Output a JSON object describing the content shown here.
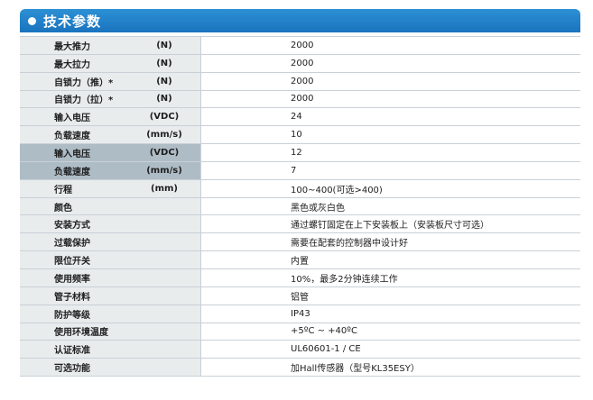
{
  "header": {
    "title": "技术参数"
  },
  "rows": [
    {
      "name": "最大推力",
      "unit": "(N)",
      "value": "2000"
    },
    {
      "name": "最大拉力",
      "unit": "(N)",
      "value": "2000"
    },
    {
      "name": "自锁力（推）*",
      "unit": "(N)",
      "value": "2000"
    },
    {
      "name": "自锁力（拉）*",
      "unit": "(N)",
      "value": "2000"
    },
    {
      "name": "输入电压",
      "unit": "(VDC)",
      "value": "24"
    },
    {
      "name": "负载速度",
      "unit": "(mm/s)",
      "value": "10"
    },
    {
      "name": "输入电压",
      "unit": "(VDC)",
      "value": "12"
    },
    {
      "name": "负载速度",
      "unit": "(mm/s)",
      "value": "7"
    },
    {
      "name": "行程",
      "unit": "(mm)",
      "value": "100~400(可选>400)"
    },
    {
      "name": "颜色",
      "unit": "",
      "value": "黑色或灰白色"
    },
    {
      "name": "安装方式",
      "unit": "",
      "value": "通过螺钉固定在上下安装板上（安装板尺寸可选）"
    },
    {
      "name": "过载保护",
      "unit": "",
      "value": "需要在配套的控制器中设计好"
    },
    {
      "name": "限位开关",
      "unit": "",
      "value": "内置"
    },
    {
      "name": "使用频率",
      "unit": "",
      "value": "10%，最多2分钟连续工作"
    },
    {
      "name": "管子材料",
      "unit": "",
      "value": "铝管"
    },
    {
      "name": "防护等级",
      "unit": "",
      "value": "IP43"
    },
    {
      "name": "使用环境温度",
      "unit": "",
      "value": "+5ºC ~ +40ºC"
    },
    {
      "name": "认证标准",
      "unit": "",
      "value": "UL60601-1 / CE"
    },
    {
      "name": "可选功能",
      "unit": "",
      "value": "加Hall传感器（型号KL35ESY）"
    }
  ]
}
